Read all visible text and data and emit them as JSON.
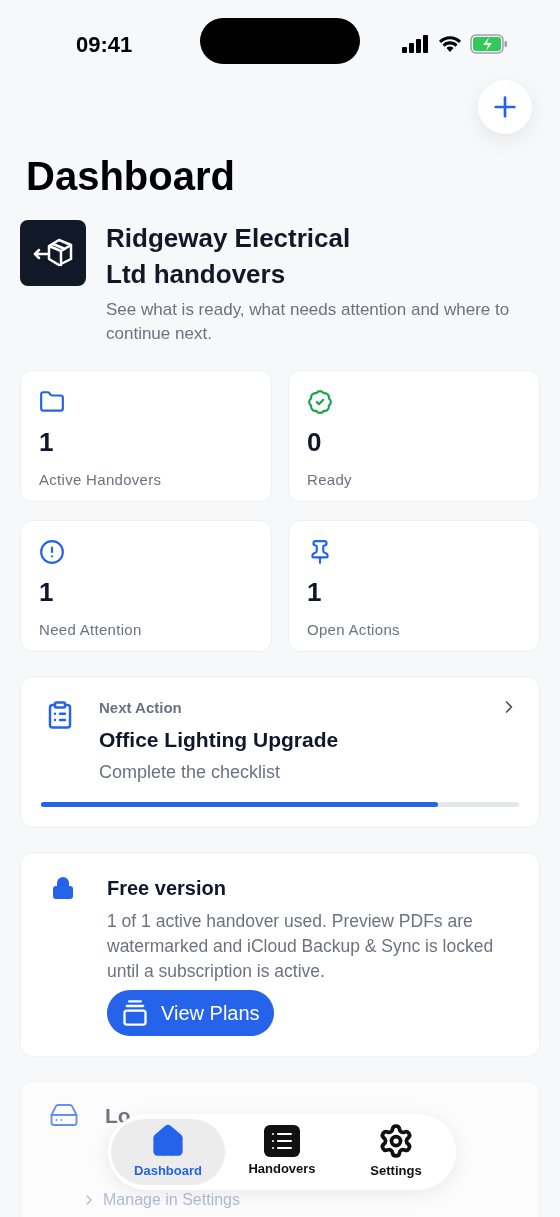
{
  "status_bar": {
    "time": "09:41"
  },
  "title": "Dashboard",
  "header": {
    "title": "Ridgeway Electrical Ltd handovers",
    "subtitle": "See what is ready, what needs attention and where to continue next."
  },
  "stats": [
    {
      "kind": "folder",
      "value": "1",
      "label": "Active Handovers"
    },
    {
      "kind": "ready",
      "value": "0",
      "label": "Ready"
    },
    {
      "kind": "attention",
      "value": "1",
      "label": "Need Attention"
    },
    {
      "kind": "pin",
      "value": "1",
      "label": "Open Actions"
    }
  ],
  "next_action": {
    "eyebrow": "Next Action",
    "title": "Office Lighting Upgrade",
    "subtitle": "Complete the checklist",
    "level": 0.83
  },
  "plan_card": {
    "title": "Free version",
    "body": "1 of 1 active handover used. Preview PDFs are watermarked and iCloud Backup & Sync is locked until a subscription is active.",
    "button": "View Plans"
  },
  "storage_card": {
    "title": "Lo",
    "link": "Manage in Settings"
  },
  "tabs": [
    {
      "kind": "home",
      "label": "Dashboard",
      "selected": true
    },
    {
      "kind": "list",
      "label": "Handovers",
      "selected": false
    },
    {
      "kind": "settings",
      "label": "Settings",
      "selected": false
    }
  ]
}
